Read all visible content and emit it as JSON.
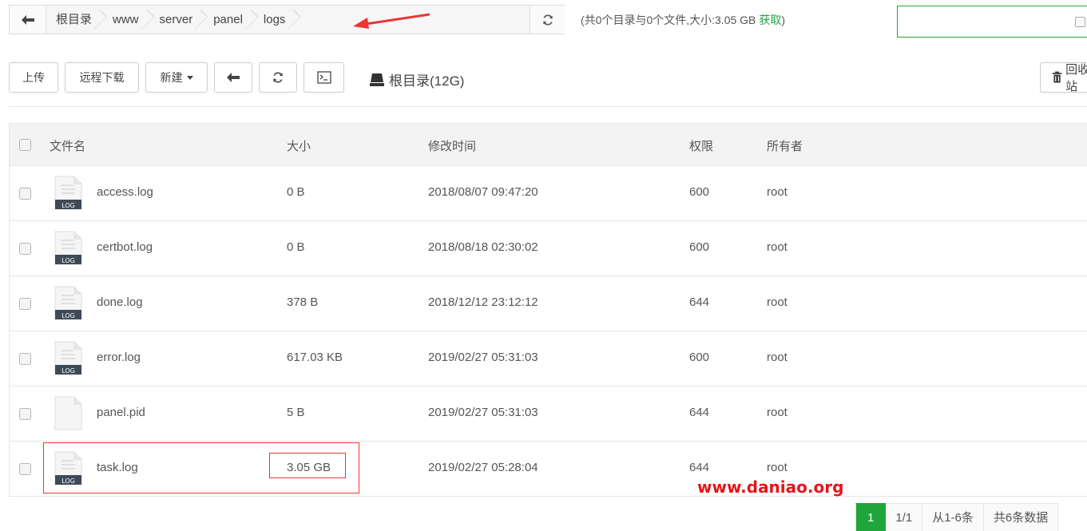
{
  "breadcrumb": {
    "items": [
      "根目录",
      "www",
      "server",
      "panel",
      "logs"
    ]
  },
  "dir_info": {
    "summary": "(共0个目录与0个文件,大小:3.05 GB",
    "fetch_label": "获取",
    "close": ")"
  },
  "toolbar": {
    "upload": "上传",
    "remote_download": "远程下载",
    "new": "新建",
    "root_dir": "根目录(12G)",
    "recycle": "回收站"
  },
  "table": {
    "headers": {
      "name": "文件名",
      "size": "大小",
      "mtime": "修改时间",
      "perm": "权限",
      "owner": "所有者"
    },
    "rows": [
      {
        "name": "access.log",
        "size": "0 B",
        "mtime": "2018/08/07 09:47:20",
        "perm": "600",
        "owner": "root",
        "icon": "log-file-icon"
      },
      {
        "name": "certbot.log",
        "size": "0 B",
        "mtime": "2018/08/18 02:30:02",
        "perm": "600",
        "owner": "root",
        "icon": "log-file-icon"
      },
      {
        "name": "done.log",
        "size": "378 B",
        "mtime": "2018/12/12 23:12:12",
        "perm": "644",
        "owner": "root",
        "icon": "log-file-icon"
      },
      {
        "name": "error.log",
        "size": "617.03 KB",
        "mtime": "2019/02/27 05:31:03",
        "perm": "600",
        "owner": "root",
        "icon": "log-file-icon"
      },
      {
        "name": "panel.pid",
        "size": "5 B",
        "mtime": "2019/02/27 05:31:03",
        "perm": "644",
        "owner": "root",
        "icon": "blank-file-icon"
      },
      {
        "name": "task.log",
        "size": "3.05 GB",
        "mtime": "2019/02/27 05:28:04",
        "perm": "644",
        "owner": "root",
        "icon": "log-file-icon"
      }
    ]
  },
  "watermark": "www.daniao.org",
  "pager": {
    "current": "1",
    "pages": "1/1",
    "range": "从1-6条",
    "total": "共6条数据"
  },
  "colors": {
    "accent": "#20a53a",
    "annotation": "#e33333"
  }
}
